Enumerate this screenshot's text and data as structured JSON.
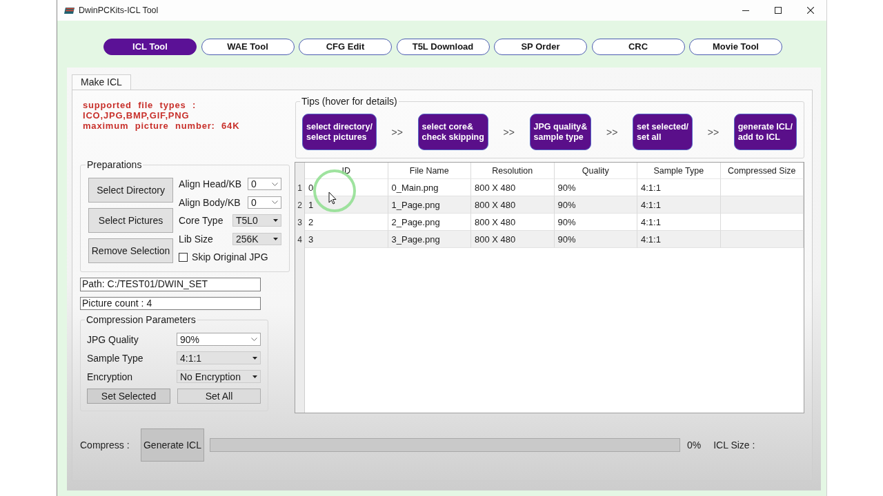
{
  "window": {
    "title": "DwinPCKits-ICL Tool"
  },
  "tool_tabs": [
    {
      "label": "ICL Tool",
      "selected": true
    },
    {
      "label": "WAE Tool",
      "selected": false
    },
    {
      "label": "CFG Edit",
      "selected": false
    },
    {
      "label": "T5L Download",
      "selected": false
    },
    {
      "label": "SP Order",
      "selected": false
    },
    {
      "label": "CRC",
      "selected": false
    },
    {
      "label": "Movie Tool",
      "selected": false
    }
  ],
  "page_tabs": [
    {
      "label": "Make ICL",
      "selected": true
    }
  ],
  "info_lines": [
    "supported file types :",
    "ICO,JPG,BMP,GIF,PNG",
    "maximum picture number: 64K"
  ],
  "preparations": {
    "title": "Preparations",
    "buttons": [
      "Select Directory",
      "Select Pictures",
      "Remove Selection"
    ],
    "options": [
      {
        "kind": "combo",
        "label": "Align Head/KB",
        "value": "0"
      },
      {
        "kind": "combo",
        "label": "Align Body/KB",
        "value": "0"
      },
      {
        "kind": "list",
        "label": "Core Type",
        "value": "T5L0"
      },
      {
        "kind": "list",
        "label": "Lib Size",
        "value": "256K"
      },
      {
        "kind": "checkbox",
        "label": "Skip Original JPG",
        "checked": false
      }
    ]
  },
  "status_fields": [
    {
      "value": "Path: C:/TEST01/DWIN_SET"
    },
    {
      "value": "Picture count : 4"
    }
  ],
  "compression": {
    "title": "Compression Parameters",
    "options": [
      {
        "kind": "combo",
        "label": "JPG Quality",
        "value": "90%"
      },
      {
        "kind": "list",
        "label": "Sample Type",
        "value": "4:1:1"
      },
      {
        "kind": "list",
        "label": "Encryption",
        "value": "No Encryption"
      }
    ],
    "buttons": [
      "Set Selected",
      "Set All"
    ]
  },
  "tips": {
    "title": "Tips (hover for details)",
    "flow": [
      {
        "kind": "step",
        "lines": [
          "select directory/",
          "select pictures"
        ]
      },
      {
        "kind": "arrow",
        "text": ">>"
      },
      {
        "kind": "step",
        "lines": [
          "select core&",
          "check skipping"
        ]
      },
      {
        "kind": "arrow",
        "text": ">>"
      },
      {
        "kind": "step",
        "lines": [
          "JPG quality&",
          "sample type"
        ]
      },
      {
        "kind": "arrow",
        "text": ">>"
      },
      {
        "kind": "step",
        "lines": [
          "set selected/",
          "set all"
        ]
      },
      {
        "kind": "arrow",
        "text": ">>"
      },
      {
        "kind": "step",
        "lines": [
          "generate ICL/",
          "add to ICL"
        ]
      }
    ]
  },
  "table": {
    "columns": [
      "ID",
      "File Name",
      "Resolution",
      "Quality",
      "Sample Type",
      "Compressed Size"
    ],
    "rows": [
      {
        "number": "1",
        "cells": [
          "0",
          "0_Main.png",
          "800 X 480",
          "90%",
          "4:1:1"
        ]
      },
      {
        "number": "2",
        "cells": [
          "1",
          "1_Page.png",
          "800 X 480",
          "90%",
          "4:1:1"
        ]
      },
      {
        "number": "3",
        "cells": [
          "2",
          "2_Page.png",
          "800 X 480",
          "90%",
          "4:1:1"
        ]
      },
      {
        "number": "4",
        "cells": [
          "3",
          "3_Page.png",
          "800 X 480",
          "90%",
          "4:1:1"
        ]
      }
    ]
  },
  "compress_bar": {
    "label": "Compress :",
    "button": "Generate ICL",
    "progress": {
      "level": 0
    },
    "percent": "0%",
    "size_label": "ICL Size :"
  }
}
